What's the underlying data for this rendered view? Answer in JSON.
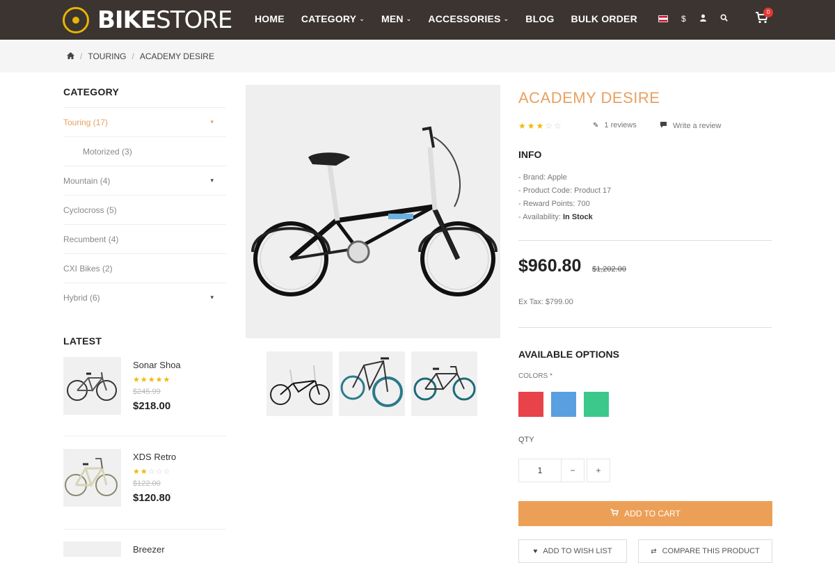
{
  "header": {
    "logo_bold": "BIKE",
    "logo_light": "STORE",
    "nav": [
      {
        "label": "HOME",
        "dropdown": false
      },
      {
        "label": "CATEGORY",
        "dropdown": true
      },
      {
        "label": "MEN",
        "dropdown": true
      },
      {
        "label": "ACCESSORIES",
        "dropdown": true
      },
      {
        "label": "BLOG",
        "dropdown": false
      },
      {
        "label": "BULK ORDER",
        "dropdown": false
      }
    ],
    "currency_symbol": "$",
    "cart_count": "0"
  },
  "breadcrumb": {
    "items": [
      "TOURING",
      "ACADEMY DESIRE"
    ]
  },
  "sidebar": {
    "category_title": "CATEGORY",
    "categories": [
      {
        "label": "Touring (17)",
        "active": true,
        "has_toggle": true,
        "sub": false
      },
      {
        "label": "Motorized (3)",
        "active": false,
        "has_toggle": false,
        "sub": true
      },
      {
        "label": "Mountain (4)",
        "active": false,
        "has_toggle": true,
        "sub": false
      },
      {
        "label": "Cyclocross (5)",
        "active": false,
        "has_toggle": false,
        "sub": false
      },
      {
        "label": "Recumbent (4)",
        "active": false,
        "has_toggle": false,
        "sub": false
      },
      {
        "label": "CXI Bikes (2)",
        "active": false,
        "has_toggle": false,
        "sub": false
      },
      {
        "label": "Hybrid (6)",
        "active": false,
        "has_toggle": true,
        "sub": false
      }
    ],
    "latest_title": "LATEST",
    "latest": [
      {
        "name": "Sonar Shoa",
        "rating": 5,
        "old_price": "$245.99",
        "price": "$218.00"
      },
      {
        "name": "XDS Retro",
        "rating": 2,
        "old_price": "$122.00",
        "price": "$120.80"
      },
      {
        "name": "Breezer",
        "rating": 0,
        "old_price": "",
        "price": ""
      }
    ]
  },
  "product": {
    "title": "ACADEMY DESIRE",
    "rating": 3,
    "reviews_label": "1 reviews",
    "write_review_label": "Write a review",
    "info_title": "INFO",
    "info": [
      {
        "label": "- Brand: ",
        "value": "Apple"
      },
      {
        "label": "- Product Code: ",
        "value": "Product 17"
      },
      {
        "label": "- Reward Points: ",
        "value": "700"
      },
      {
        "label": "- Availability: ",
        "value": "In Stock"
      }
    ],
    "price": "$960.80",
    "old_price": "$1,202.00",
    "ex_tax": "Ex Tax: $799.00",
    "options_title": "AVAILABLE OPTIONS",
    "colors_label": "COLORS *",
    "colors": [
      "#e8424a",
      "#5aa0e0",
      "#3cc88a"
    ],
    "qty_label": "QTY",
    "qty_value": "1",
    "qty_minus": "−",
    "qty_plus": "+",
    "add_to_cart_label": "ADD TO CART",
    "wishlist_label": "ADD TO WISH LIST",
    "compare_label": "COMPARE THIS PRODUCT"
  }
}
